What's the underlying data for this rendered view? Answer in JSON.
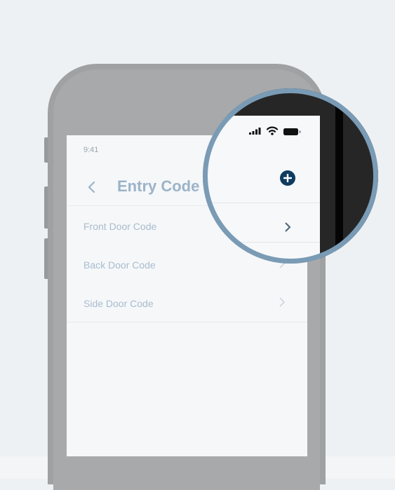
{
  "status_bar": {
    "time": "9:41"
  },
  "nav": {
    "title": "Entry Code",
    "back_icon": "chevron-left-icon",
    "add_icon": "plus-circle-icon"
  },
  "entry_codes": [
    {
      "label": "Front Door Code"
    },
    {
      "label": "Back Door Code"
    },
    {
      "label": "Side Door Code"
    }
  ],
  "colors": {
    "background": "#eef1f4",
    "phone_frame": "#9fa1a3",
    "screen": "#f5f7f9",
    "title_text": "#9cb3c8",
    "row_text": "#a9bccd",
    "magnifier_ring": "#7a9bb5",
    "add_button": "#0f3b5f"
  }
}
